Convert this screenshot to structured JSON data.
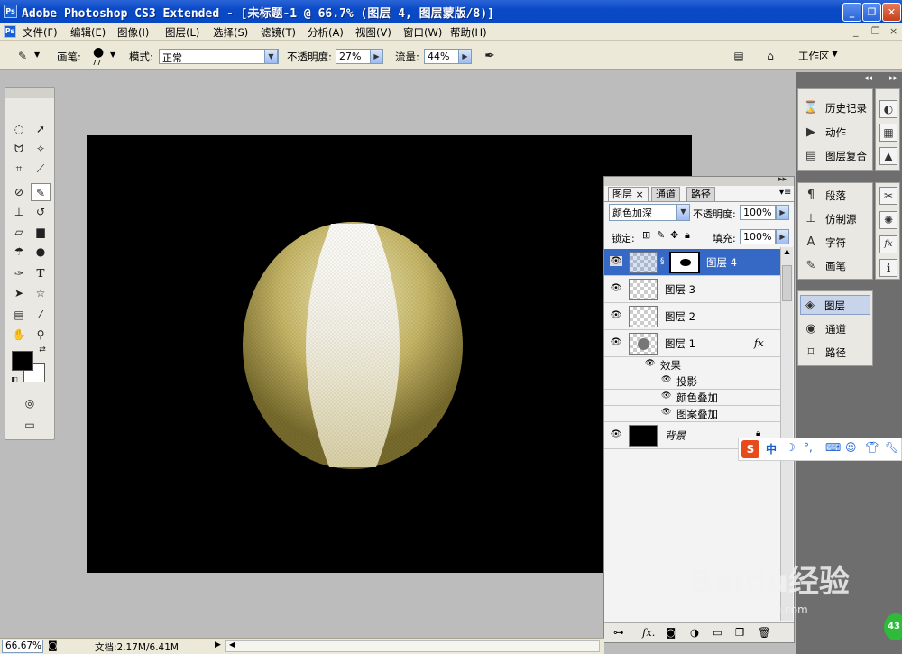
{
  "window": {
    "title": "Adobe Photoshop CS3 Extended - [未标题-1 @ 66.7% (图层 4, 图层蒙版/8)]",
    "app_icon": "Ps",
    "minimize": "_",
    "restore": "❐",
    "close": "✕"
  },
  "menu": {
    "items": [
      "文件(F)",
      "编辑(E)",
      "图像(I)",
      "图层(L)",
      "选择(S)",
      "滤镜(T)",
      "分析(A)",
      "视图(V)",
      "窗口(W)",
      "帮助(H)"
    ],
    "mdi_min": "_",
    "mdi_restore": "❐",
    "mdi_close": "×"
  },
  "options": {
    "brush_label": "画笔:",
    "brush_size": "77",
    "mode_label": "模式:",
    "mode_value": "正常",
    "opacity_label": "不透明度:",
    "opacity_value": "27%",
    "flow_label": "流量:",
    "flow_value": "44%",
    "workspace_label": "工作区"
  },
  "layers_panel": {
    "tabs": [
      "图层",
      "通道",
      "路径"
    ],
    "blend_mode": "颜色加深",
    "opacity_label": "不透明度:",
    "opacity_value": "100%",
    "lock_label": "锁定:",
    "fill_label": "填充:",
    "fill_value": "100%",
    "layers": [
      {
        "name": "图层 4"
      },
      {
        "name": "图层 3"
      },
      {
        "name": "图层 2"
      },
      {
        "name": "图层 1",
        "fx": "fx"
      }
    ],
    "effects_label": "效果",
    "effects": [
      "投影",
      "颜色叠加",
      "图案叠加"
    ],
    "background_name": "背景"
  },
  "right_dock": {
    "group1": [
      "历史记录",
      "动作",
      "图层复合"
    ],
    "group2": [
      "段落",
      "仿制源",
      "字符",
      "画笔"
    ],
    "group3": [
      "图层",
      "通道",
      "路径"
    ]
  },
  "status": {
    "zoom": "66.67%",
    "doc_info": "文档:2.17M/6.41M"
  },
  "ime": {
    "label": "中"
  },
  "watermark": {
    "brand": "Baidu经验",
    "url": "jingyan.baidu.com",
    "badge": "43"
  },
  "colors": {
    "titlebar": "#0a4ac8",
    "selected_layer": "#3569c5",
    "canvas": "#000000",
    "workspace": "#bcbcbc"
  }
}
